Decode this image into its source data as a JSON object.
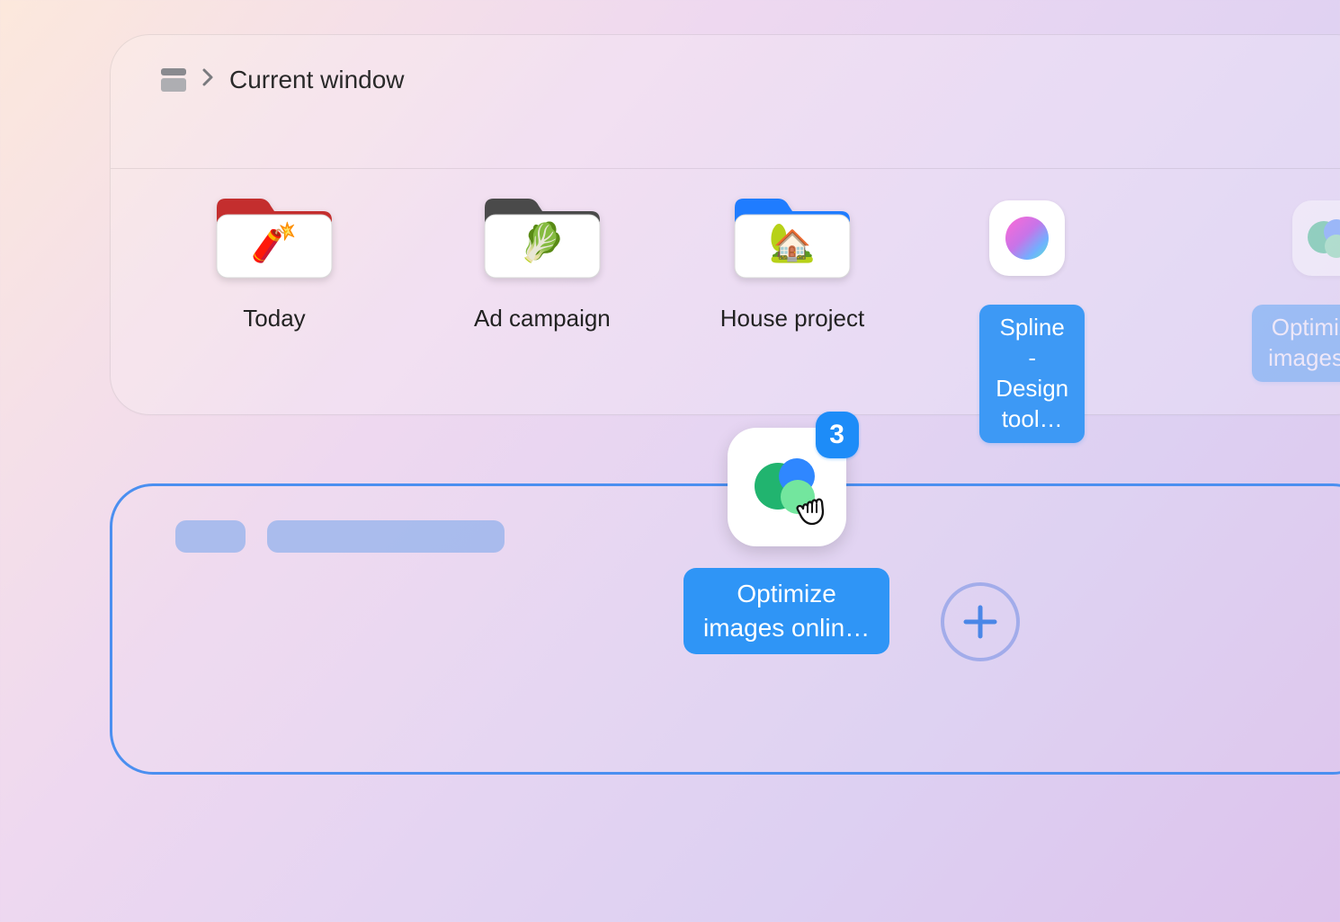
{
  "breadcrumb": {
    "label": "Current window"
  },
  "topPanel": {
    "items": [
      {
        "kind": "folder",
        "label": "Today",
        "color": "#d33",
        "emoji": "🧨"
      },
      {
        "kind": "folder",
        "label": "Ad campaign",
        "color": "#555",
        "emoji": "🥬"
      },
      {
        "kind": "folder",
        "label": "House project",
        "color": "#2a7cff",
        "emoji": "🏡"
      },
      {
        "kind": "app",
        "label_line1": "Spline -",
        "label_line2": "Design tool…",
        "selected": true
      },
      {
        "kind": "app",
        "label_line1": "Optimize",
        "label_line2": "images…",
        "selected": true,
        "faded": true,
        "partial": true
      }
    ]
  },
  "drag": {
    "badge": "3",
    "label_line1": "Optimize",
    "label_line2": "images onlin…"
  }
}
